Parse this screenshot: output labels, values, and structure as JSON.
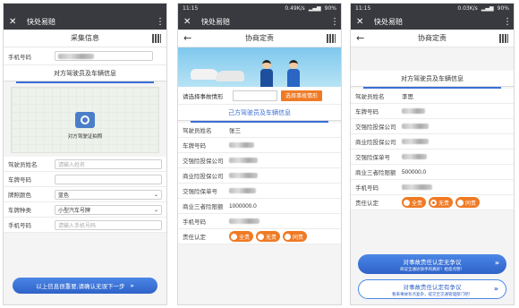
{
  "phone1": {
    "title": "快处易赔",
    "header": "采集信息",
    "phone_label": "手机号码",
    "section": "对方驾驶员及车辆信息",
    "photo_caption": "对方驾驶证拍照",
    "fields": [
      {
        "label": "驾驶员姓名",
        "placeholder": "请输入姓名"
      },
      {
        "label": "车牌号码",
        "placeholder": ""
      },
      {
        "label": "牌照颜色",
        "value": "蓝色"
      },
      {
        "label": "车牌种类",
        "value": "小型汽车号牌"
      },
      {
        "label": "手机号码",
        "placeholder": "请输入手机号码"
      }
    ],
    "confirm_button": "以上信息很重要,请确认无误下一步"
  },
  "phone2": {
    "status_time": "11:15",
    "status_speed": "0.49K/s",
    "status_battery": "90%",
    "title": "快处易赔",
    "header": "协商定责",
    "pick_label": "请选择事故情形",
    "pick_button": "选择事故情形",
    "section": "己方驾驶员及车辆信息",
    "rows": [
      {
        "label": "驾驶员姓名",
        "value": "张三"
      },
      {
        "label": "车牌号码",
        "value": ""
      },
      {
        "label": "交强险投保公司",
        "value": ""
      },
      {
        "label": "商业险投保公司",
        "value": ""
      },
      {
        "label": "交强险保单号",
        "value": ""
      },
      {
        "label": "商业三者险限额",
        "value": "1000000.0"
      },
      {
        "label": "手机号码",
        "value": ""
      }
    ],
    "responsibility_label": "责任认定",
    "options": [
      "全责",
      "无责",
      "同责"
    ]
  },
  "phone3": {
    "status_time": "11:15",
    "status_speed": "0.03K/s",
    "status_battery": "90%",
    "title": "快处易赔",
    "header": "协商定责",
    "section": "对方驾驶员及车辆信息",
    "rows": [
      {
        "label": "驾驶员姓名",
        "value": "李思"
      },
      {
        "label": "车牌号码",
        "value": ""
      },
      {
        "label": "交强险投保公司",
        "value": ""
      },
      {
        "label": "商业险投保公司",
        "value": ""
      },
      {
        "label": "交强险保单号",
        "value": ""
      },
      {
        "label": "商业三者险限额",
        "value": "500000.0"
      },
      {
        "label": "手机号码",
        "value": ""
      }
    ],
    "responsibility_label": "责任认定",
    "options": [
      "全责",
      "无责",
      "同责"
    ],
    "agree_button": "对事故责任认定无争议",
    "agree_sub": "商议全通达快手的真好！给您点赞！",
    "dispute_button": "对事故责任认定有争议",
    "dispute_sub": "看来事故有点复杂，提交至交通管理部门吧！"
  },
  "colors": {
    "accent": "#3a6fd6",
    "orange": "#f07a24",
    "bar": "#393a3f"
  }
}
